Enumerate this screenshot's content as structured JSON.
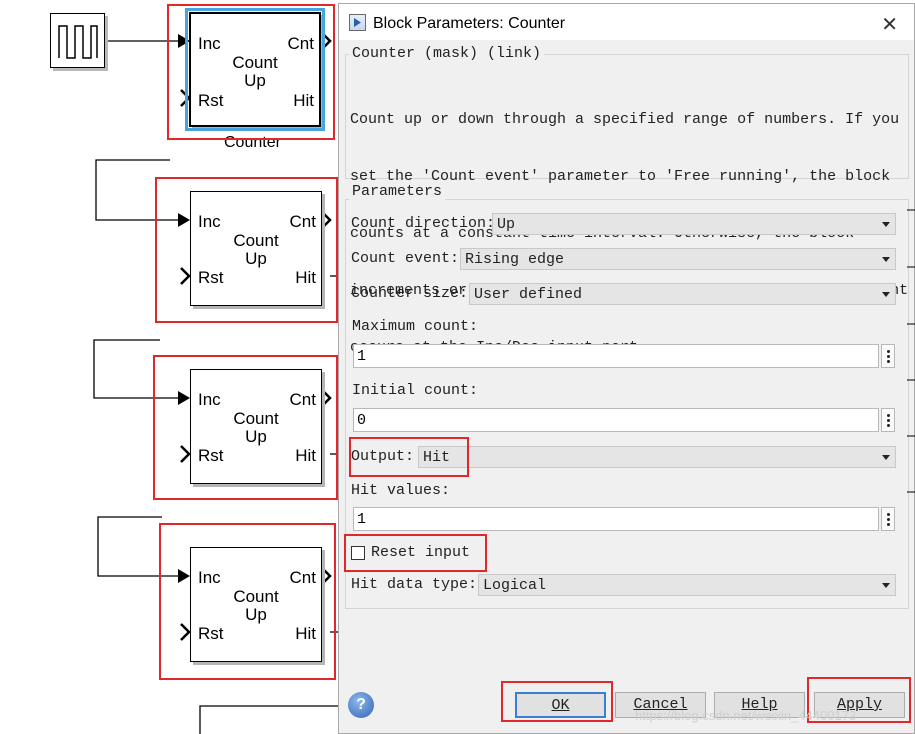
{
  "canvas": {
    "top_block": {
      "inc": "Inc",
      "cnt": "Cnt",
      "rst": "Rst",
      "hit": "Hit",
      "title_line1": "Count",
      "title_line2": "Up",
      "caption": "Counter"
    },
    "blocks": [
      {
        "inc": "Inc",
        "cnt": "Cnt",
        "rst": "Rst",
        "hit": "Hit",
        "title_line1": "Count",
        "title_line2": "Up"
      },
      {
        "inc": "Inc",
        "cnt": "Cnt",
        "rst": "Rst",
        "hit": "Hit",
        "title_line1": "Count",
        "title_line2": "Up"
      },
      {
        "inc": "Inc",
        "cnt": "Cnt",
        "rst": "Rst",
        "hit": "Hit",
        "title_line1": "Count",
        "title_line2": "Up"
      }
    ]
  },
  "dialog": {
    "title": "Block Parameters: Counter",
    "icon": "simulink-block-icon",
    "mask_group_label": "Counter (mask) (link)",
    "description_lines": [
      "Count up or down through a specified range of numbers. If you",
      "set the 'Count event' parameter to 'Free running', the block",
      "counts at a constant time interval. Otherwise, the block",
      "increments or decrements the counter each time a trigger event",
      "occurs at the Inc/Dec input port."
    ],
    "params_group_label": "Parameters",
    "count_direction": {
      "label": "Count direction:",
      "value": "Up"
    },
    "count_event": {
      "label": "Count event:",
      "value": "Rising edge"
    },
    "counter_size": {
      "label": "Counter size:",
      "value": "User defined"
    },
    "maximum_count": {
      "label": "Maximum count:",
      "value": "1"
    },
    "initial_count": {
      "label": "Initial count:",
      "value": "0"
    },
    "output": {
      "label": "Output:",
      "value": "Hit"
    },
    "hit_values": {
      "label": "Hit values:",
      "value": "1"
    },
    "reset_input": {
      "label": "Reset input",
      "checked": false
    },
    "hit_data_type": {
      "label": "Hit data type:",
      "value": "Logical"
    },
    "buttons": {
      "ok": "OK",
      "cancel": "Cancel",
      "help": "Help",
      "apply": "Apply"
    },
    "watermark": "https://blog.csdn.net/weixin_44400173"
  },
  "colors": {
    "highlight": "#e0272b",
    "selection": "#49a3df"
  }
}
